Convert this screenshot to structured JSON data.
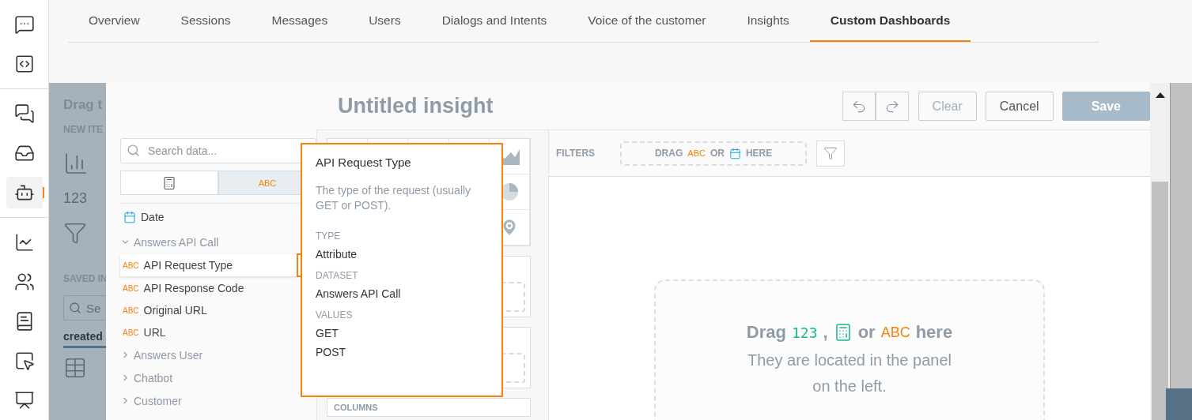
{
  "nav": {
    "items": [
      {
        "kind": "chat",
        "selected": false
      },
      {
        "kind": "code",
        "selected": false
      },
      {
        "kind": "divider"
      },
      {
        "kind": "conversations",
        "selected": false
      },
      {
        "kind": "inbox",
        "selected": false
      },
      {
        "kind": "bot",
        "selected": true
      },
      {
        "kind": "divider"
      },
      {
        "kind": "analytics",
        "selected": false
      },
      {
        "kind": "users",
        "selected": false
      },
      {
        "kind": "book",
        "selected": false
      },
      {
        "kind": "pointer",
        "selected": false
      },
      {
        "kind": "board",
        "selected": false
      }
    ]
  },
  "tabs": [
    {
      "label": "Overview",
      "selected": false
    },
    {
      "label": "Sessions",
      "selected": false
    },
    {
      "label": "Messages",
      "selected": false
    },
    {
      "label": "Users",
      "selected": false
    },
    {
      "label": "Dialogs and Intents",
      "selected": false
    },
    {
      "label": "Voice of the customer",
      "selected": false
    },
    {
      "label": "Insights",
      "selected": false
    },
    {
      "label": "Custom Dashboards",
      "selected": true
    }
  ],
  "backdrop": {
    "heading": "Drag t",
    "new_items_label": "NEW ITE",
    "items": [
      {
        "kind": "bars"
      },
      {
        "kind": "number",
        "text": "123"
      },
      {
        "kind": "funnel"
      }
    ],
    "saved_label": "SAVED IN",
    "search_placeholder": "Se",
    "tab_label": "created"
  },
  "header": {
    "title": "Untitled insight",
    "buttons": [
      {
        "label": "Clear",
        "kind": "secondary",
        "disabled": true
      },
      {
        "label": "Cancel",
        "kind": "secondary",
        "disabled": false
      },
      {
        "label": "Save",
        "kind": "primary",
        "disabled": false
      }
    ]
  },
  "data_panel": {
    "search_placeholder": "Search data...",
    "type_toggle": [
      {
        "kind": "calc",
        "selected": false
      },
      {
        "kind": "text",
        "label": "ABC",
        "selected": true
      }
    ],
    "items": [
      {
        "kind": "date",
        "label": "Date"
      },
      {
        "kind": "group",
        "label": "Answers API Call",
        "expanded": true,
        "children": [
          {
            "badge": "ABC",
            "label": "API Request Type",
            "selected": true
          },
          {
            "badge": "ABC",
            "label": "API Response Code",
            "selected": false
          },
          {
            "badge": "ABC",
            "label": "Original URL",
            "selected": false
          },
          {
            "badge": "ABC",
            "label": "URL",
            "selected": false
          }
        ]
      },
      {
        "kind": "group",
        "label": "Answers User",
        "expanded": false
      },
      {
        "kind": "group",
        "label": "Chatbot",
        "expanded": false
      },
      {
        "kind": "group",
        "label": "Customer",
        "expanded": false
      }
    ]
  },
  "chart_types": [
    {
      "kind": "area"
    },
    {
      "kind": "pie"
    },
    {
      "kind": "map"
    }
  ],
  "columns_label": "COLUMNS",
  "filters": {
    "label": "FILTERS",
    "hint": [
      {
        "kind": "text",
        "text": "DRAG"
      },
      {
        "kind": "tag",
        "text": "ABC"
      },
      {
        "kind": "text",
        "text": "OR"
      },
      {
        "kind": "date"
      },
      {
        "kind": "text",
        "text": "HERE"
      }
    ]
  },
  "drop_zone": {
    "heading": [
      {
        "kind": "text",
        "text": "Drag"
      },
      {
        "kind": "metric",
        "text": "123"
      },
      {
        "kind": "text",
        "text": ","
      },
      {
        "kind": "calc"
      },
      {
        "kind": "text",
        "text": "or"
      },
      {
        "kind": "tag",
        "text": "ABC"
      },
      {
        "kind": "text",
        "text": "here"
      }
    ],
    "subtext": "They are located in the panel on the left."
  },
  "tooltip": {
    "title": "API Request Type",
    "description": "The type of the request (usually GET or POST).",
    "fields": [
      {
        "label": "TYPE",
        "values": [
          "Attribute"
        ]
      },
      {
        "label": "DATASET",
        "values": [
          "Answers API Call"
        ]
      },
      {
        "label": "VALUES",
        "values": [
          "GET",
          "POST"
        ]
      }
    ]
  }
}
